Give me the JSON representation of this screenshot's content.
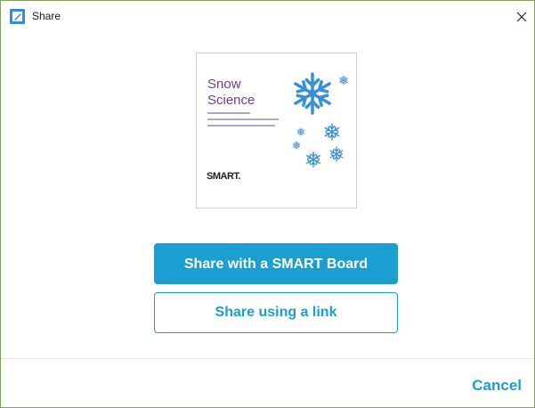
{
  "window": {
    "title": "Share",
    "icon": "smart-notebook-icon",
    "close_icon": "close-icon"
  },
  "preview": {
    "title_line1": "Snow",
    "title_line2": "Science",
    "logo": "SMART."
  },
  "actions": {
    "share_board_label": "Share with a SMART Board",
    "share_link_label": "Share using a link"
  },
  "footer": {
    "cancel_label": "Cancel"
  },
  "colors": {
    "accent": "#1a9fd0",
    "title_purple": "#6a3f97",
    "snowflake": "#3b8fd4",
    "window_border": "#7fa35a"
  }
}
